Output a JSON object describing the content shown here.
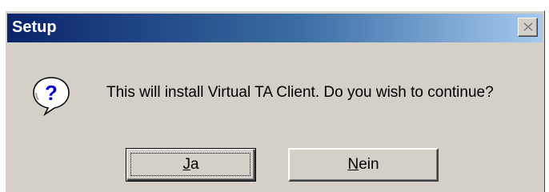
{
  "dialog": {
    "title": "Setup",
    "message": "This will install Virtual TA Client. Do you wish to continue?",
    "icon": "question-icon",
    "buttons": {
      "yes": {
        "mnemonic": "J",
        "rest": "a"
      },
      "no": {
        "mnemonic": "N",
        "rest": "ein"
      }
    },
    "colors": {
      "titlebar_start": "#0a246a",
      "titlebar_end": "#a6caf0",
      "face": "#d4d0c8"
    }
  }
}
